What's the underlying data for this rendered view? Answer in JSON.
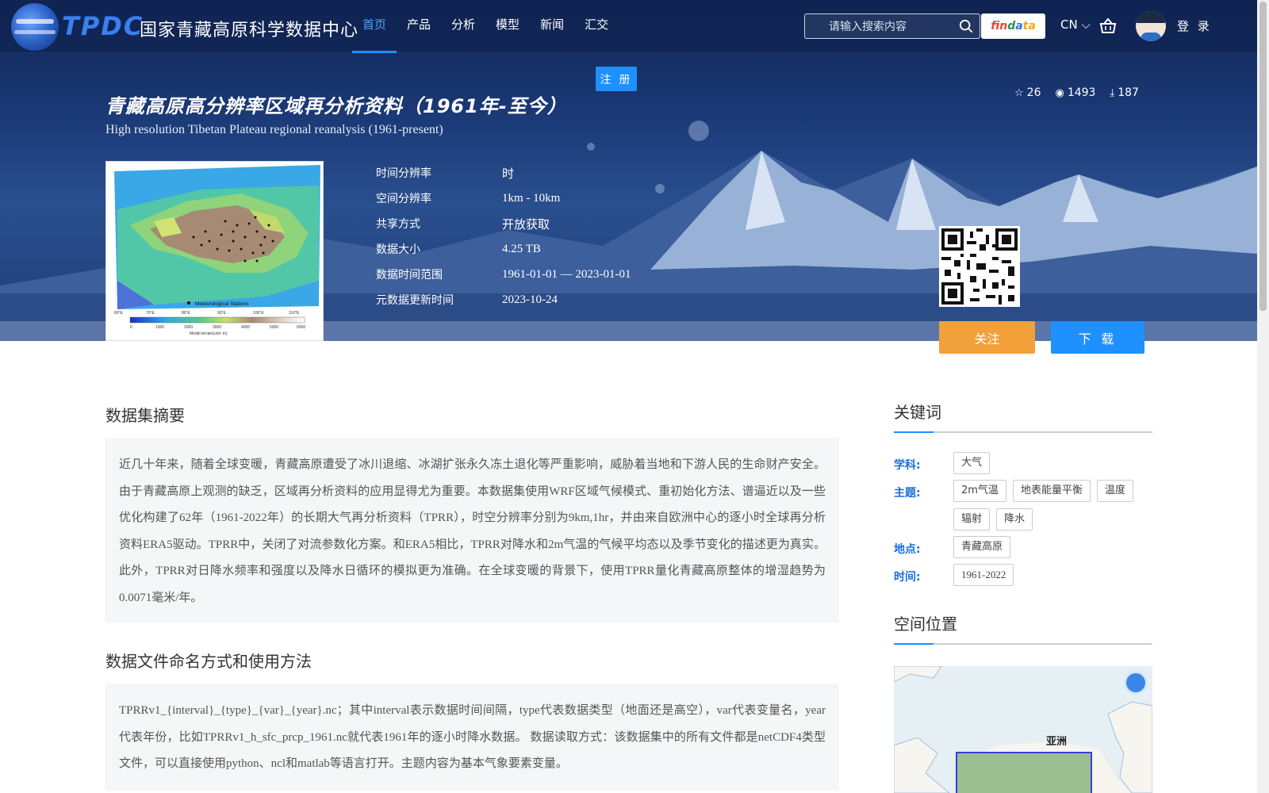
{
  "logo": {
    "en": "TPDC",
    "cn": "国家青藏高原科学数据中心"
  },
  "nav": {
    "items": [
      "首页",
      "产品",
      "分析",
      "模型",
      "新闻",
      "汇交"
    ]
  },
  "search": {
    "placeholder": "请输入搜索内容"
  },
  "findata": {
    "p1": "fin",
    "p2": "d",
    "p3": "a",
    "p4": "ta"
  },
  "lang": "CN",
  "login": "登 录",
  "register": "注 册",
  "dataset": {
    "title": "青藏高原高分辨率区域再分析资料（1961年-至今）",
    "subtitle": "High resolution Tibetan Plateau regional reanalysis (1961-present)",
    "stars": "26",
    "views": "1493",
    "downloads": "187",
    "meta": [
      {
        "k": "时间分辨率",
        "v": "时"
      },
      {
        "k": "空间分辨率",
        "v": "1km - 10km"
      },
      {
        "k": "共享方式",
        "v": "开放获取"
      },
      {
        "k": "数据大小",
        "v": "4.25 TB"
      },
      {
        "k": "数据时间范围",
        "v": "1961-01-01 — 2023-01-01"
      },
      {
        "k": "元数据更新时间",
        "v": "2023-10-24"
      }
    ],
    "follow": "关注",
    "download": "下 载"
  },
  "thumb": {
    "legend": "Meteorological Stations",
    "colorbar_ticks": [
      "0",
      "1000",
      "2000",
      "3000",
      "4000",
      "5000",
      "6000"
    ],
    "colorbar_label": "Model terrain(unit: m)",
    "lon_ticks": [
      "60°E",
      "70°E",
      "80°E",
      "90°E",
      "100°E",
      "110°E"
    ]
  },
  "abstract": {
    "heading": "数据集摘要",
    "text": "近几十年来，随着全球变暖，青藏高原遭受了冰川退缩、冰湖扩张永久冻土退化等严重影响，威胁着当地和下游人民的生命财产安全。由于青藏高原上观测的缺乏，区域再分析资料的应用显得尤为重要。本数据集使用WRF区域气候模式、重初始化方法、谱逼近以及一些优化构建了62年（1961-2022年）的长期大气再分析资料（TPRR），时空分辨率分别为9km,1hr，并由来自欧洲中心的逐小时全球再分析资料ERA5驱动。TPRR中，关闭了对流参数化方案。和ERA5相比，TPRR对降水和2m气温的气候平均态以及季节变化的描述更为真实。此外，TPRR对日降水频率和强度以及降水日循环的模拟更为准确。在全球变暖的背景下，使用TPRR量化青藏高原整体的增湿趋势为0.0071毫米/年。"
  },
  "naming": {
    "heading": "数据文件命名方式和使用方法",
    "text": "TPRRv1_{interval}_{type}_{var}_{year}.nc；其中interval表示数据时间间隔，type代表数据类型（地面还是高空），var代表变量名，year代表年份，比如TPRRv1_h_sfc_prcp_1961.nc就代表1961年的逐小时降水数据。 数据读取方式：该数据集中的所有文件都是netCDF4类型文件，可以直接使用python、ncl和matlab等语言打开。主题内容为基本气象要素变量。"
  },
  "keywords": {
    "heading": "关键词",
    "groups": [
      {
        "label": "学科:",
        "tags": [
          "大气"
        ]
      },
      {
        "label": "主题:",
        "tags": [
          "2m气温",
          "地表能量平衡",
          "温度",
          "辐射",
          "降水"
        ]
      },
      {
        "label": "地点:",
        "tags": [
          "青藏高原"
        ]
      },
      {
        "label": "时间:",
        "tags": [
          "1961-2022"
        ]
      }
    ]
  },
  "location": {
    "heading": "空间位置",
    "map_label": "亚洲"
  },
  "colors": {
    "accent": "#1e90ff",
    "follow": "#f1a03a",
    "keyword_label": "#1a6fd6"
  }
}
